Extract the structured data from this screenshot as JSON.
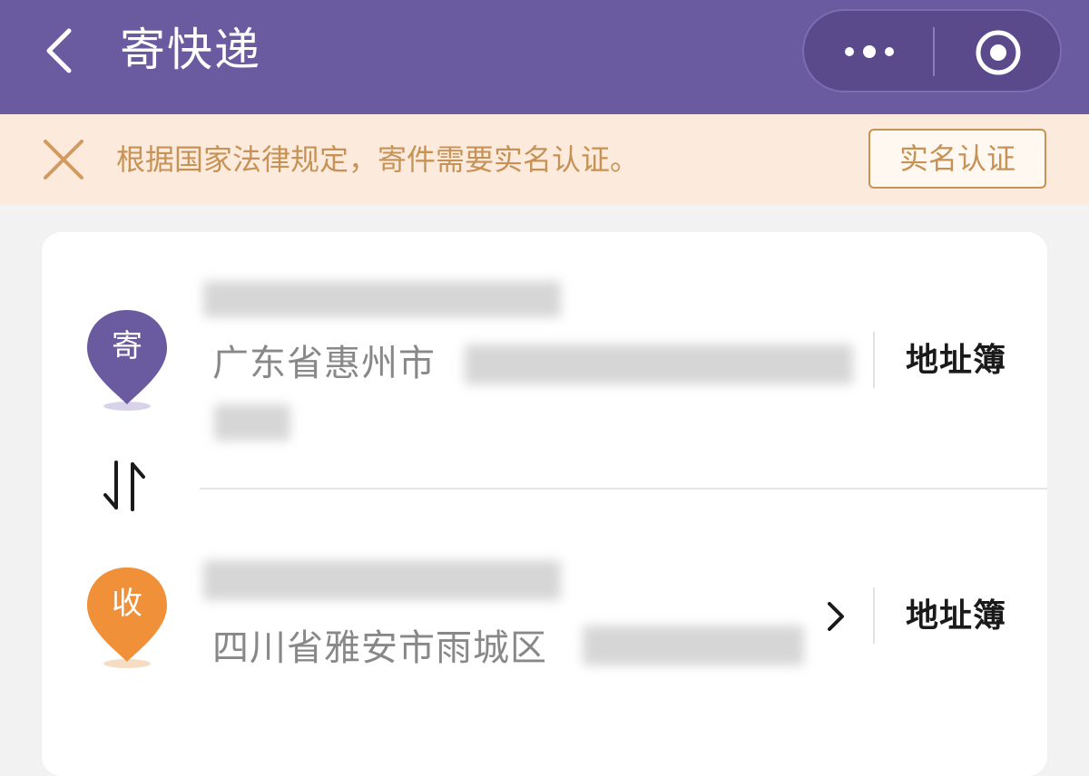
{
  "header": {
    "title": "寄快递"
  },
  "notice": {
    "text": "根据国家法律规定，寄件需要实名认证。",
    "button_label": "实名认证"
  },
  "sender": {
    "badge": "寄",
    "address_prefix": "广东省惠州市",
    "address_book_label": "地址簿"
  },
  "receiver": {
    "badge": "收",
    "address_prefix": "四川省雅安市雨城区",
    "address_book_label": "地址簿"
  },
  "colors": {
    "header_bg": "#6a5aa0",
    "notice_bg": "#fcebdc",
    "notice_accent": "#c69256",
    "sender_pin": "#6a5aa0",
    "receiver_pin": "#f0913a"
  },
  "icons": {
    "back": "back-chevron-icon",
    "more": "more-dots-icon",
    "target": "target-icon",
    "notice_close": "close-icon",
    "swap": "swap-arrows-icon",
    "chevron": "chevron-right-icon"
  }
}
